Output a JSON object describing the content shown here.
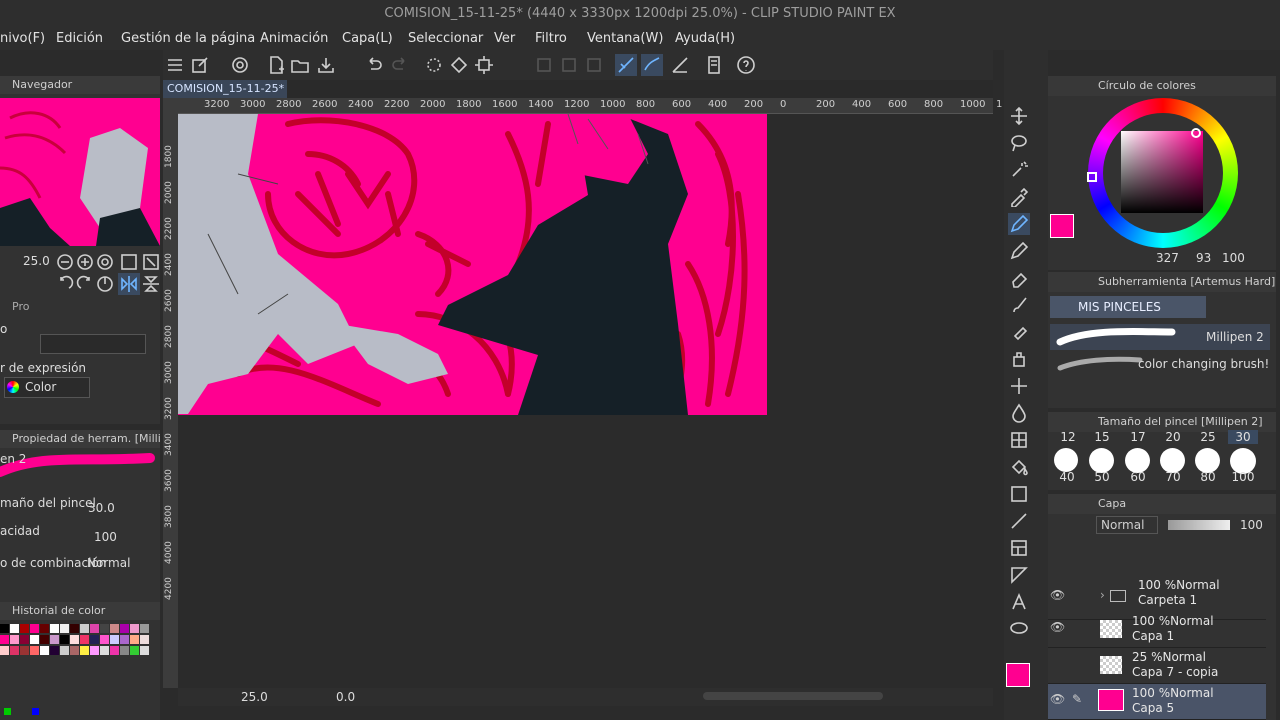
{
  "app": {
    "title": "COMISION_15-11-25* (4440 x 3330px 1200dpi 25.0%) - CLIP STUDIO PAINT EX"
  },
  "menu": [
    "nivo(F)",
    "Edición",
    "Gestión de la página",
    "Animación",
    "Capa(L)",
    "Seleccionar",
    "Ver",
    "Filtro",
    "Ventana(W)",
    "Ayuda(H)"
  ],
  "document_tab": {
    "label": "COMISION_15-11-25*",
    "close": "●"
  },
  "ruler": {
    "top_ticks": [
      "3200",
      "3000",
      "2800",
      "2600",
      "2400",
      "2200",
      "2000",
      "1800",
      "1600",
      "1400",
      "1200",
      "1000",
      "800",
      "600",
      "400",
      "200",
      "0",
      "200",
      "400",
      "600",
      "800",
      "1000",
      "1"
    ],
    "left_ticks": [
      "1800",
      "2000",
      "2200",
      "2400",
      "2600",
      "2800",
      "3000",
      "3200",
      "3400",
      "3600",
      "3800",
      "4000",
      "4200"
    ]
  },
  "navigator": {
    "title": "Navegador",
    "zoom": "25.0"
  },
  "tool_property": {
    "tabs_label": "Pro",
    "section_label": "o",
    "expression_label": "r de expresión",
    "expression_value": "Color",
    "title": "Propiedad de herram. [Millipen 2]",
    "brush_name": "en 2",
    "size_label": "maño del pincel",
    "size_value": "30.0",
    "opacity_label": "acidad",
    "opacity_value": "100",
    "blend_label": "o de combinación",
    "blend_value": "Normal"
  },
  "color_history": {
    "title": "Historial de color"
  },
  "statusbar": {
    "zoom": "25.0",
    "angle": "0.0"
  },
  "color_wheel": {
    "title": "Círculo de colores",
    "main_color": "#ff0090",
    "sub_color": "#111a1f",
    "h": "327",
    "s": "93",
    "v": "100"
  },
  "sub_tool": {
    "title": "Subherramienta [Artemus Hard]",
    "group": "MIS PINCELES",
    "items": [
      "Millipen 2",
      "color changing brush!"
    ]
  },
  "brush_size": {
    "title": "Tamaño del pincel [Millipen 2]",
    "top_values": [
      "12",
      "15",
      "17",
      "20",
      "25",
      "30"
    ],
    "values": [
      "40",
      "50",
      "60",
      "70",
      "80",
      "100"
    ]
  },
  "layers": {
    "title": "Capa",
    "blend": "Normal",
    "opacity": "100",
    "items": [
      {
        "pct": "100 %Normal",
        "name": "Carpeta 1"
      },
      {
        "pct": "100 %Normal",
        "name": "Capa 1"
      },
      {
        "pct": "25 %Normal",
        "name": "Capa 7 - copia"
      },
      {
        "pct": "100 %Normal",
        "name": "Capa 5"
      }
    ]
  }
}
